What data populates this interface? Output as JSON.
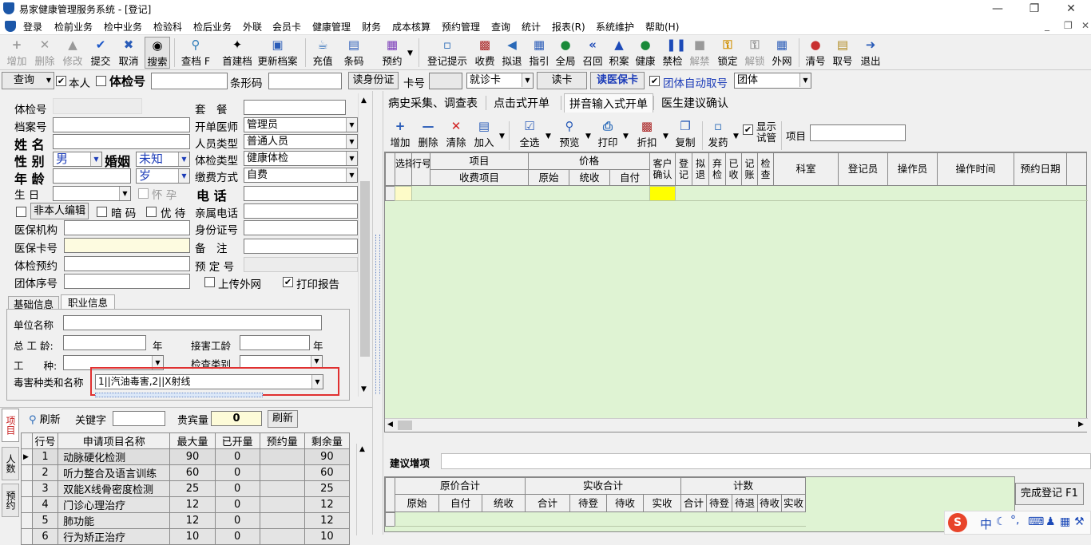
{
  "window": {
    "title": "易家健康管理服务系统 - [登记]"
  },
  "menu": [
    "登录",
    "检前业务",
    "检中业务",
    "检验科",
    "检后业务",
    "外联",
    "会员卡",
    "健康管理",
    "财务",
    "成本核算",
    "预约管理",
    "查询",
    "统计",
    "报表(R)",
    "系统维护",
    "帮助(H)"
  ],
  "toolbar": {
    "add": "增加",
    "delete": "删除",
    "modify": "修改",
    "submit": "提交",
    "cancel": "取消",
    "search": "搜索",
    "lookup": "查档 F",
    "build": "首建档",
    "update": "更新档案",
    "recharge": "充值",
    "barcode": "条码",
    "reserve": "预约",
    "reg_hint": "登记提示",
    "charge": "收费",
    "refund": "拟退",
    "guide": "指引",
    "global": "全局",
    "return": "召回",
    "accumulate": "积案",
    "health": "健康",
    "forbid": "禁检",
    "unforbid": "解禁",
    "lock": "锁定",
    "unlock": "解锁",
    "external": "外网",
    "clear_no": "清号",
    "take_no": "取号",
    "exit": "退出"
  },
  "searchbar": {
    "query": "查询",
    "self": "本人",
    "exam_no_label": "体检号",
    "barcode_label": "条形码",
    "read_id": "读身份证",
    "card_no": "卡号",
    "card_type": "就诊卡",
    "read_card": "读卡",
    "read_medical": "读医保卡",
    "auto_group": "团体自动取号",
    "group": "团体"
  },
  "form": {
    "exam_no": "体检号",
    "package": "套　餐",
    "file_no": "档案号",
    "doctor_label": "开单医师",
    "doctor": "管理员",
    "name": "姓 名",
    "person_type_label": "人员类型",
    "person_type": "普通人员",
    "gender_label": "性 别",
    "gender": "男",
    "marital_label": "婚姻",
    "marital": "未知",
    "exam_type_label": "体检类型",
    "exam_type": "健康体检",
    "age_label": "年 龄",
    "age_unit": "岁",
    "pay_label": "缴费方式",
    "pay": "自费",
    "birth_label": "生 日",
    "pregnant": "怀 孕",
    "phone_label": "电 话",
    "not_self_edit": "非本人编辑",
    "relative_phone": "亲属电话",
    "secret": "暗 码",
    "priority": "优 待",
    "id_no": "身份证号",
    "med_org": "医保机构",
    "remark": "备　注",
    "med_card": "医保卡号",
    "reserve_no": "预 定 号",
    "exam_reserve": "体检预约",
    "upload": "上传外网",
    "group_seq": "团体序号",
    "print_report": "打印报告"
  },
  "tabs_info": [
    "基础信息",
    "职业信息"
  ],
  "occupation": {
    "company": "单位名称",
    "total_years": "总 工 龄:",
    "year1": "年",
    "exposure_years": "接害工龄",
    "year2": "年",
    "work_type": "工　　种:",
    "check_type": "检查类别",
    "hazard_label": "毒害种类和名称",
    "hazard_value": "1||汽油毒害,2||X射线"
  },
  "bottom_left": {
    "refresh": "刷新",
    "keyword": "关键字",
    "vip": "贵宾量",
    "vip_value": "0",
    "refresh2": "刷新",
    "vtabs": [
      "项目",
      "人数",
      "预约"
    ],
    "columns": [
      "行号",
      "申请项目名称",
      "最大量",
      "已开量",
      "预约量",
      "剩余量"
    ],
    "rows": [
      [
        "1",
        "动脉硬化检测",
        "90",
        "0",
        "",
        "90"
      ],
      [
        "2",
        "听力整合及语言训练",
        "60",
        "0",
        "",
        "60"
      ],
      [
        "3",
        "双能X线骨密度检测",
        "25",
        "0",
        "",
        "25"
      ],
      [
        "4",
        "门诊心理治疗",
        "12",
        "0",
        "",
        "12"
      ],
      [
        "5",
        "肺功能",
        "12",
        "0",
        "",
        "12"
      ],
      [
        "6",
        "行为矫正治疗",
        "10",
        "0",
        "",
        "10"
      ]
    ]
  },
  "right_tabs": [
    "病史采集、调查表",
    "点击式开单",
    "拼音输入式开单",
    "医生建议确认"
  ],
  "right_toolbar": {
    "add": "增加",
    "delete": "删除",
    "clear": "清除",
    "join": "加入",
    "selall": "全选",
    "preview": "预览",
    "print": "打印",
    "discount": "折扣",
    "copy": "复制",
    "send": "发药",
    "show_trial": "显示试管",
    "item": "项目"
  },
  "grid_headers": {
    "select": "选择",
    "row": "行号",
    "item": "项目",
    "charge_item": "收费项目",
    "price": "价格",
    "orig": "原始",
    "unified": "统收",
    "self": "自付",
    "client_confirm": "客户确认",
    "reg": "登记",
    "prop": "拟退",
    "give": "弃检",
    "paid": "已收",
    "acct": "记账",
    "check": "检查",
    "dept": "科室",
    "registrar": "登记员",
    "operator": "操作员",
    "op_time": "操作时间",
    "reserve_date": "预约日期"
  },
  "suggest": {
    "label": "建议增项",
    "orig_total": "原价合计",
    "real_total": "实收合计",
    "count": "计数",
    "cols": [
      "原始",
      "自付",
      "统收",
      "合计",
      "待登",
      "待收",
      "实收",
      "合计",
      "待登",
      "待退",
      "待收",
      "实收"
    ],
    "complete": "完成登记 F1"
  }
}
